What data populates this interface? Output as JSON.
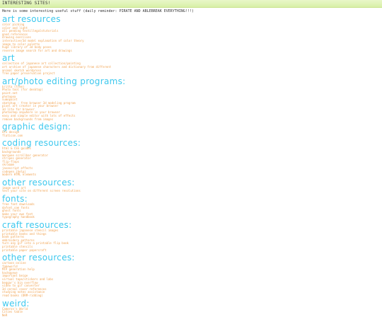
{
  "page": {
    "title": "INTERESTING SITES!",
    "intro": "Here is some interesting useful stuff (daily reminder: PIRATE AND ABLEBREAK EVERYTHING!!!)"
  },
  "sections": [
    {
      "title": "art resources",
      "links": [
        "color picking",
        "color and light",
        "all pending textillegalstutorials",
        "good references",
        "drawing exercises",
        "interactive/3d model explanation of color theory",
        "image to color palette",
        "huge library of 3d body poses",
        "reverse image search for art and drawings"
      ]
    },
    {
      "title": "art",
      "links": [
        "collection of japanese art collection/painting",
        "art archive of japanese characters and dictionary from different",
        "animal sketch wordpress",
        "free paper preservation project"
      ]
    },
    {
      "title": "art/photo editing programs:",
      "links": [
        "kritta (free)",
        "Photo tool (for desktop)",
        "paint.net",
        "photopea",
        "sumopaint",
        "sketchup - free browser 3d modeling program",
        "pixel art creator in your browser",
        "3d lite for browser",
        "photoshop anywhere in your browser",
        "easy and simple editor with lots of effects",
        "remove backgrounds from images"
      ]
    },
    {
      "title": "graphic design:",
      "links": [
        "Gfx design",
        "flaticon.com"
      ]
    },
    {
      "title": "coding resources:",
      "links": [
        "html & CSS guides",
        "backgrounds",
        "marquee scrollbar generator",
        "stripes generator",
        "flip-flops",
        "skraaam",
        "javascript effects",
        "codepen (help)",
        "modern HTML elements"
      ]
    },
    {
      "title": "other resources:",
      "links": [
        "image word art",
        "test your site on different screen resolutions"
      ]
    },
    {
      "title": "fonts:",
      "links": [
        "free font downloads",
        "dafont.com fonts",
        "ghost fonts",
        "make your own font",
        "typography handbook"
      ]
    },
    {
      "title": "craft resources:",
      "links": [
        "printable japanese stencil images",
        "printable books and things",
        "book patterns",
        "embroidery patterns",
        "turn any gif into a printable flip book",
        "printable stencils",
        "printable paper papercraft"
      ]
    },
    {
      "title": "other resources:",
      "links": [
        "cartoon online",
        "fakeworld",
        "MTP generation help",
        "hackqueue",
        "important beige",
        "virtual tape/stickers and labs",
        "beggar's bin overflow",
        "video to gif converter",
        "3d cereal cover references",
        "studying notes assistance",
        "read books (DRM-ridding)"
      ]
    },
    {
      "title": "weird:",
      "links": [
        "Cameron's World",
        "Cities table",
        "NeR"
      ]
    }
  ]
}
